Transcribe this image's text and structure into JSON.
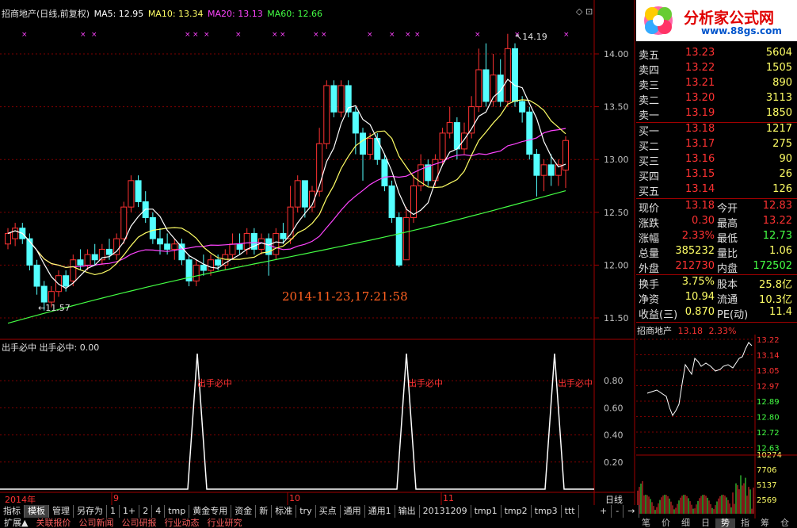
{
  "stock": {
    "name": "招商地产",
    "mode": "(日线,前复权)"
  },
  "ma": {
    "ma5": {
      "label": "MA5: 12.95",
      "color": "#ffffff"
    },
    "ma10": {
      "label": "MA10: 13.34",
      "color": "#ffff66"
    },
    "ma20": {
      "label": "MA20: 13.13",
      "color": "#ff44ff"
    },
    "ma60": {
      "label": "MA60: 12.66",
      "color": "#44ff44"
    }
  },
  "price_axis": [
    "14.00",
    "13.50",
    "13.00",
    "12.50",
    "12.00",
    "11.50"
  ],
  "annotations": {
    "high": "14.19",
    "low": "11.57",
    "timestamp": "2014-11-23,17:21:58"
  },
  "indicator": {
    "title": "出手必中 出手必中: 0.00",
    "signal_label": "出手必中",
    "axis": [
      "0.80",
      "0.60",
      "0.40",
      "0.20"
    ]
  },
  "time_axis": {
    "year": "2014年",
    "m9": "9",
    "m10": "10",
    "m11": "11",
    "period": "日线"
  },
  "logo": {
    "text": "分析家公式网",
    "url": "www.88gs.com"
  },
  "orderbook": {
    "sell": [
      {
        "label": "卖五",
        "price": "13.23",
        "vol": "5604"
      },
      {
        "label": "卖四",
        "price": "13.22",
        "vol": "1505"
      },
      {
        "label": "卖三",
        "price": "13.21",
        "vol": "890"
      },
      {
        "label": "卖二",
        "price": "13.20",
        "vol": "3113"
      },
      {
        "label": "卖一",
        "price": "13.19",
        "vol": "1850"
      }
    ],
    "buy": [
      {
        "label": "买一",
        "price": "13.18",
        "vol": "1217"
      },
      {
        "label": "买二",
        "price": "13.17",
        "vol": "275"
      },
      {
        "label": "买三",
        "price": "13.16",
        "vol": "90"
      },
      {
        "label": "买四",
        "price": "13.15",
        "vol": "26"
      },
      {
        "label": "买五",
        "price": "13.14",
        "vol": "126"
      }
    ]
  },
  "quote": [
    {
      "l1": "现价",
      "v1": "13.18",
      "l2": "今开",
      "v2": "12.83"
    },
    {
      "l1": "涨跌",
      "v1": "0.30",
      "l2": "最高",
      "v2": "13.22"
    },
    {
      "l1": "涨幅",
      "v1": "2.33%",
      "l2": "最低",
      "v2": "12.73"
    },
    {
      "l1": "总量",
      "v1": "385232",
      "l2": "量比",
      "v2": "1.06"
    },
    {
      "l1": "外盘",
      "v1": "212730",
      "l2": "内盘",
      "v2": "172502"
    }
  ],
  "fund": [
    {
      "l1": "换手",
      "v1": "3.75%",
      "l2": "股本",
      "v2": "25.8亿"
    },
    {
      "l1": "净资",
      "v1": "10.94",
      "l2": "流通",
      "v2": "10.3亿"
    },
    {
      "l1": "收益(三)",
      "v1": "0.870",
      "l2": "PE(动)",
      "v2": "11.4"
    }
  ],
  "mini": {
    "name": "招商地产",
    "price": "13.18",
    "pct": "2.33%",
    "axis": [
      "13.22",
      "13.14",
      "13.05",
      "12.97",
      "12.89",
      "12.80",
      "12.72",
      "12.63"
    ],
    "vol_axis": [
      "10274",
      "7706",
      "5137",
      "2569"
    ]
  },
  "toolbar": [
    "指标",
    "模板",
    "管理",
    "另存为",
    "1",
    "1+",
    "2",
    "4",
    "tmp",
    "黄金专用",
    "资金",
    "新",
    "标准",
    "try",
    "买点",
    "通用",
    "通用1",
    "输出",
    "20131209",
    "tmp1",
    "tmp2",
    "tmp3",
    "ttt"
  ],
  "toolbar_right": [
    "+",
    "-",
    "→"
  ],
  "bottombar": [
    "扩展▲",
    "关联报价",
    "公司新闻",
    "公司研报",
    "行业动态",
    "行业研究"
  ],
  "mini_tabs": [
    "笔",
    "价",
    "细",
    "日",
    "势",
    "指",
    "筹",
    "仓"
  ],
  "colors": {
    "up": "#ff3232",
    "down": "#54ffff",
    "grid": "#800000",
    "accent_red": "#e00000"
  }
}
